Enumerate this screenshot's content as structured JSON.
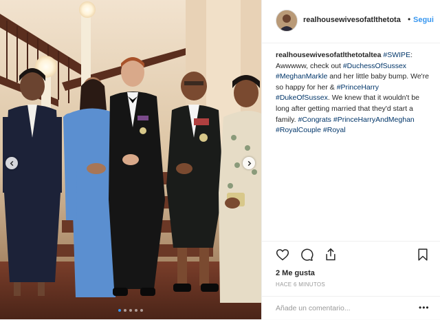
{
  "post": {
    "photo": {
      "description_icon": "photo-carousel",
      "carousel_total": 5,
      "carousel_active": 1
    },
    "header": {
      "username": "realhousewivesofatlthetota",
      "follow_dot": "•",
      "follow_label": "Segui"
    },
    "caption": {
      "username": "realhousewivesofatlthetotaltea",
      "segments": [
        {
          "text": "#SWIPE",
          "tag": true
        },
        {
          "text": ": Awwwww, check out ",
          "tag": false
        },
        {
          "text": "#DuchessOfSussex",
          "tag": true
        },
        {
          "text": " ",
          "tag": false
        },
        {
          "text": "#MeghanMarkle",
          "tag": true
        },
        {
          "text": " and her little baby bump. We're so happy for her & ",
          "tag": false
        },
        {
          "text": "#PrinceHarry",
          "tag": true
        },
        {
          "text": " ",
          "tag": false
        },
        {
          "text": "#DukeOfSussex",
          "tag": true
        },
        {
          "text": ". We knew that it wouldn't be long after getting married that they'd start a family. ",
          "tag": false
        },
        {
          "text": "#Congrats",
          "tag": true
        },
        {
          "text": " ",
          "tag": false
        },
        {
          "text": "#PrinceHarryAndMeghan",
          "tag": true
        },
        {
          "text": " ",
          "tag": false
        },
        {
          "text": "#RoyalCouple",
          "tag": true
        },
        {
          "text": " ",
          "tag": false
        },
        {
          "text": "#Royal",
          "tag": true
        }
      ]
    },
    "actions": {
      "icons": [
        "heart-icon",
        "comment-icon",
        "share-icon",
        "bookmark-icon"
      ]
    },
    "likes_label": "2 Me gusta",
    "time_label": "HACE 6 MINUTOS",
    "comment": {
      "placeholder": "Añade un comentario...",
      "more_label": "•••"
    },
    "colors": {
      "link": "#3897f0",
      "hashtag": "#003569",
      "text": "#262626",
      "muted": "#999999",
      "dress": "#5b8fd0"
    }
  }
}
